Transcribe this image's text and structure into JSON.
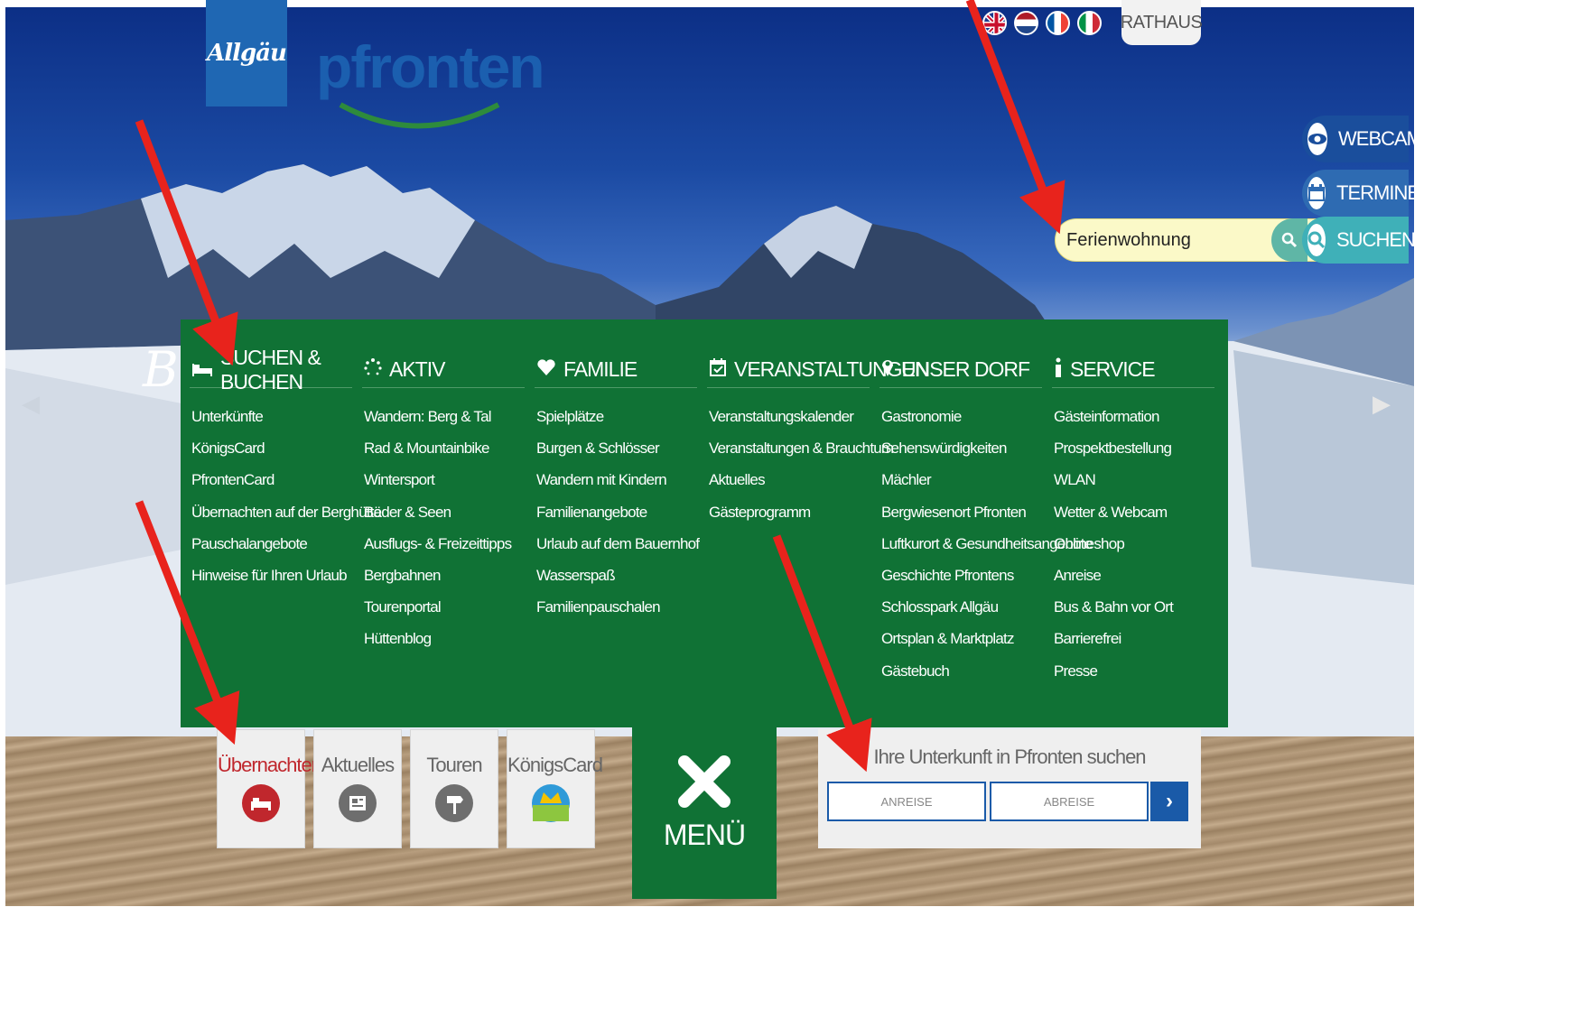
{
  "header": {
    "logo_mark": "Allgäu",
    "logo_name": "pfronten",
    "rathaus": "RATHAUS",
    "languages": [
      "english-flag-icon",
      "dutch-flag-icon",
      "french-flag-icon",
      "italian-flag-icon"
    ]
  },
  "side": {
    "webcam": "WEBCAM",
    "termine": "TERMINE",
    "suchen": "SUCHEN",
    "search_value": "Ferienwohnung"
  },
  "hero": {
    "partial_heading": "Be"
  },
  "menu": {
    "columns": [
      {
        "title": "SUCHEN & BUCHEN",
        "icon": "bed-icon",
        "items": [
          "Unterkünfte",
          "KönigsCard",
          "PfrontenCard",
          "Übernachten auf der Berghütte",
          "Pauschalangebote",
          "Hinweise für Ihren Urlaub"
        ]
      },
      {
        "title": "AKTIV",
        "icon": "activity-icon",
        "items": [
          "Wandern: Berg & Tal",
          "Rad & Mountainbike",
          "Wintersport",
          "Bäder & Seen",
          "Ausflugs- & Freizeittipps",
          "Bergbahnen",
          "Tourenportal",
          "Hüttenblog"
        ]
      },
      {
        "title": "FAMILIE",
        "icon": "heart-icon",
        "items": [
          "Spielplätze",
          "Burgen & Schlösser",
          "Wandern mit Kindern",
          "Familienangebote",
          "Urlaub auf dem Bauernhof",
          "Wasserspaß",
          "Familienpauschalen"
        ]
      },
      {
        "title": "VERANSTALTUNGEN",
        "icon": "calendar-check-icon",
        "items": [
          "Veranstaltungskalender",
          "Veranstaltungen & Brauchtum",
          "Aktuelles",
          "Gästeprogramm"
        ]
      },
      {
        "title": "UNSER DORF",
        "icon": "map-pin-icon",
        "items": [
          "Gastronomie",
          "Sehenswürdigkeiten",
          "Mächler",
          "Bergwiesenort Pfronten",
          "Luftkurort & Gesundheitsangebote",
          "Geschichte Pfrontens",
          "Schlosspark Allgäu",
          "Ortsplan & Marktplatz",
          "Gästebuch"
        ]
      },
      {
        "title": "SERVICE",
        "icon": "info-icon",
        "items": [
          "Gästeinformation",
          "Prospektbestellung",
          "WLAN",
          "Wetter & Webcam",
          "Onlineshop",
          "Anreise",
          "Bus & Bahn vor Ort",
          "Barrierefrei",
          "Presse"
        ]
      }
    ]
  },
  "tiles": [
    {
      "label": "Übernachten",
      "color": "#c0272d",
      "icon": "bed-icon"
    },
    {
      "label": "Aktuelles",
      "color": "#6e6e6e",
      "icon": "news-icon"
    },
    {
      "label": "Touren",
      "color": "#6e6e6e",
      "icon": "signpost-icon"
    },
    {
      "label": "KönigsCard",
      "color": "#f4c300",
      "icon": "crown-icon"
    }
  ],
  "menu_button": {
    "label": "MENÜ"
  },
  "booking": {
    "title": "Ihre Unterkunft in Pfronten suchen",
    "arrival": "ANREISE",
    "departure": "ABREISE"
  },
  "colors": {
    "menu_green": "#107235",
    "accent_blue": "#1a5aa8",
    "highlight_red": "#c0272d"
  }
}
